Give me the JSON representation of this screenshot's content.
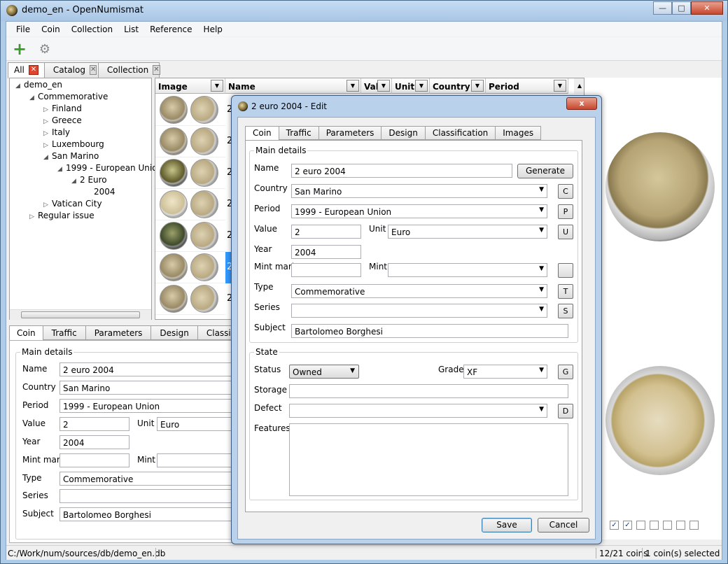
{
  "window": {
    "title": "demo_en - OpenNumismat"
  },
  "menu": [
    "File",
    "Coin",
    "Collection",
    "List",
    "Reference",
    "Help"
  ],
  "top_tabs": [
    {
      "label": "All"
    },
    {
      "label": "Catalog"
    },
    {
      "label": "Collection"
    }
  ],
  "tree": {
    "root": "demo_en",
    "commemorative": "Commemorative",
    "finland": "Finland",
    "greece": "Greece",
    "italy": "Italy",
    "luxembourg": "Luxembourg",
    "san_marino": "San Marino",
    "period": "1999 - European Union",
    "value": "2 Euro",
    "year": "2004",
    "vatican": "Vatican City",
    "regular": "Regular issue"
  },
  "grid": {
    "headers": {
      "image": "Image",
      "name": "Name",
      "value": "Valu",
      "unit": "Unit",
      "country": "Country",
      "period": "Period"
    },
    "rows": [
      "2",
      "2",
      "2",
      "2",
      "2",
      "2",
      "2"
    ]
  },
  "bottom_tabs": [
    "Coin",
    "Traffic",
    "Parameters",
    "Design",
    "Classification"
  ],
  "details": {
    "group": "Main details",
    "name_label": "Name",
    "name": "2 euro 2004",
    "country_label": "Country",
    "country": "San Marino",
    "period_label": "Period",
    "period": "1999 - European Union",
    "value_label": "Value",
    "value": "2",
    "unit_label": "Unit",
    "unit": "Euro",
    "year_label": "Year",
    "year": "2004",
    "mintmark_label": "Mint mark",
    "mint_label": "Mint",
    "type_label": "Type",
    "type": "Commemorative",
    "series_label": "Series",
    "subject_label": "Subject",
    "subject": "Bartolomeo Borghesi"
  },
  "dialog": {
    "title": "2 euro 2004 - Edit",
    "close": "x",
    "tabs": [
      "Coin",
      "Traffic",
      "Parameters",
      "Design",
      "Classification",
      "Images"
    ],
    "main_group": "Main details",
    "name_label": "Name",
    "name": "2 euro 2004",
    "generate": "Generate",
    "country_label": "Country",
    "country": "San Marino",
    "country_btn": "C",
    "period_label": "Period",
    "period": "1999 - European Union",
    "period_btn": "P",
    "value_label": "Value",
    "value": "2",
    "unit_label": "Unit",
    "unit": "Euro",
    "unit_btn": "U",
    "year_label": "Year",
    "year": "2004",
    "mintmark_label": "Mint mark",
    "mint_label": "Mint",
    "type_label": "Type",
    "type": "Commemorative",
    "type_btn": "T",
    "series_label": "Series",
    "series_btn": "S",
    "subject_label": "Subject",
    "subject": "Bartolomeo Borghesi",
    "state_group": "State",
    "status_label": "Status",
    "status": "Owned",
    "grade_label": "Grade",
    "grade": "XF",
    "grade_btn": "G",
    "storage_label": "Storage",
    "defect_label": "Defect",
    "defect_btn": "D",
    "features_label": "Features",
    "save": "Save",
    "cancel": "Cancel"
  },
  "status_bar": {
    "path": "C:/Work/num/sources/db/demo_en.db",
    "count": "12/21 coins",
    "selected": "1 coin(s) selected"
  },
  "image_checks": [
    true,
    true,
    false,
    false,
    false,
    false,
    false
  ]
}
